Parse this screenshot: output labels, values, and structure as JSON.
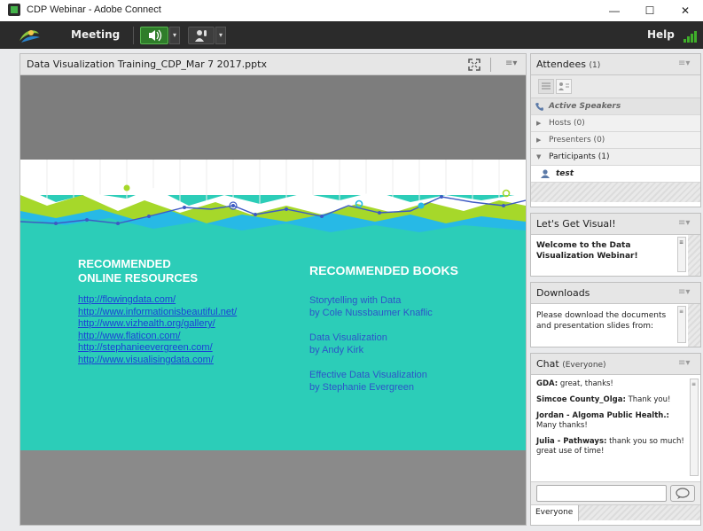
{
  "window": {
    "title": "CDP Webinar - Adobe Connect",
    "minimize": "—",
    "maximize": "☐",
    "close": "✕"
  },
  "menubar": {
    "meeting": "Meeting",
    "help": "Help",
    "dropdown_glyph": "▾"
  },
  "share_pod": {
    "title": "Data Visualization Training_CDP_Mar 7 2017.pptx",
    "menu_glyph": "≡▾"
  },
  "slide": {
    "resources_heading_line1": "RECOMMENDED",
    "resources_heading_line2": "ONLINE RESOURCES",
    "books_heading": "RECOMMENDED BOOKS",
    "links": [
      "http://flowingdata.com/",
      "http://www.informationisbeautiful.net/",
      "http://www.vizhealth.org/gallery/",
      "http://www.flaticon.com/",
      "http://stephanieevergreen.com/",
      "http://www.visualisingdata.com/"
    ],
    "books": [
      {
        "title": "Storytelling with Data",
        "author": "by Cole Nussbaumer Knaflic"
      },
      {
        "title": "Data Visualization",
        "author": "by Andy Kirk"
      },
      {
        "title": "Effective Data Visualization",
        "author": "by Stephanie Evergreen"
      }
    ]
  },
  "attendees": {
    "title": "Attendees",
    "count": "(1)",
    "active_speakers": "Active Speakers",
    "hosts": "Hosts (0)",
    "presenters": "Presenters (0)",
    "participants": "Participants (1)",
    "user": "test"
  },
  "lets_get_visual": {
    "title": "Let's Get Visual!",
    "text": "Welcome to the Data Visualization Webinar!"
  },
  "downloads": {
    "title": "Downloads",
    "text": "Please download the documents and presentation slides from:"
  },
  "chat": {
    "title": "Chat",
    "scope": "(Everyone)",
    "messages": [
      {
        "sender": "GDA:",
        "text": "great, thanks!"
      },
      {
        "sender": "Simcoe County_Olga:",
        "text": "Thank you!"
      },
      {
        "sender": "Jordan - Algoma Public Health.:",
        "text": "Many thanks!"
      },
      {
        "sender": "Julia - Pathways:",
        "text": "thank you so much! great use of time!"
      }
    ],
    "tab": "Everyone"
  },
  "colors": {
    "menubar": "#2b2b2b",
    "slide_teal": "#2ccdb8",
    "link_blue": "#1b3fd6",
    "accent_green": "#a6d82a"
  }
}
